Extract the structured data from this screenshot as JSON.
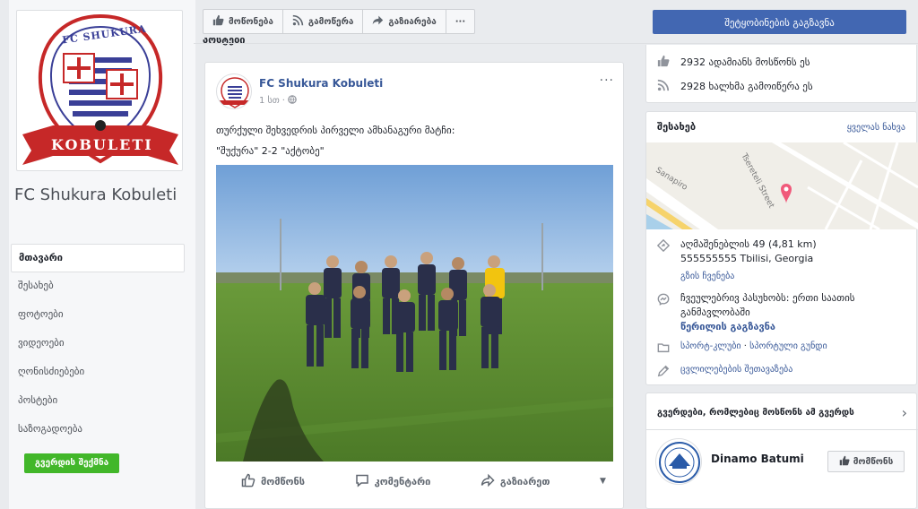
{
  "page": {
    "name": "FC Shukura Kobuleti",
    "logo_text_top": "FC SHUKURA",
    "logo_text_bottom": "KOBULETI"
  },
  "left_nav": {
    "items": [
      {
        "label": "მთავარი",
        "active": true
      },
      {
        "label": "შესახებ"
      },
      {
        "label": "ფოტოები"
      },
      {
        "label": "ვიდეოები"
      },
      {
        "label": "ღონისძიებები"
      },
      {
        "label": "პოსტები"
      },
      {
        "label": "საზოგადოება"
      }
    ],
    "create_page_label": "გვერდის შექმნა"
  },
  "action_bar": {
    "like_label": "მოწონება",
    "follow_label": "გამოწერა",
    "share_label": "გაზიარება",
    "more_label": "···"
  },
  "message_button_label": "შეტყობინების გაგზავნა",
  "posts_header": "პოსტები",
  "post": {
    "author": "FC Shukura Kobuleti",
    "time": "1 სთ",
    "menu": "···",
    "text_line1": "თურქული შეხვედრის პირველი ამხანაგური მატჩი:",
    "text_line2": "\"შუქურა\" 2-2 \"აქტობე\"",
    "actions": {
      "like": "მომწონს",
      "comment": "კომენტარი",
      "share": "გაზიარეთ"
    }
  },
  "stats": {
    "likes": "2932 ადამიანს მოსწონს ეს",
    "follows": "2928 ხალხმა გამოიწერა ეს"
  },
  "about": {
    "title": "შესახებ",
    "see_all": "ყველას ნახვა",
    "map_labels": {
      "street1": "Sanapiro",
      "street2": "Tsereteli Street"
    },
    "address_line1": "აღმაშენებლის 49 (4,81 km)",
    "address_line2": "555555555 Tbilisi, Georgia",
    "directions": "გზის ჩვენება",
    "response": "ჩვეულებრივ პასუხობს: ერთი საათის განმავლობაში",
    "send_message": "წერილის გაგზავნა",
    "category_part1": "სპორტ-კლუბი",
    "category_sep": " · ",
    "category_part2": "სპორტული გუნდი",
    "suggest_edits": "ცვლილებების შეთავაზება"
  },
  "liked_pages": {
    "title": "გვერდები, რომლებიც მოსწონს ამ გვერდს",
    "items": [
      {
        "name": "Dinamo Batumi",
        "like_label": "მომწონს"
      }
    ]
  },
  "colors": {
    "brand_blue": "#4267b2",
    "link": "#385898",
    "green": "#42b72a",
    "background": "#e9ebee"
  }
}
